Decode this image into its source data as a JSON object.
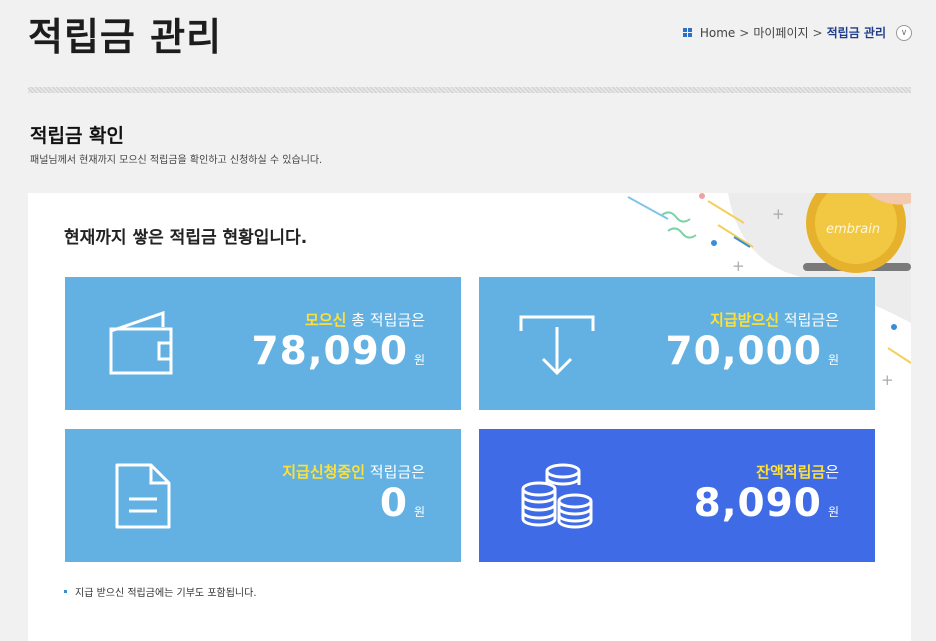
{
  "header": {
    "title": "적립금 관리",
    "breadcrumb": {
      "home": "Home",
      "parent": "마이페이지",
      "current": "적립금 관리",
      "separator": ">"
    }
  },
  "section": {
    "title": "적립금 확인",
    "description": "패널님께서 현재까지 모으신 적립금을 확인하고 신청하실 수 있습니다."
  },
  "panel": {
    "heading": "현재까지 쌓은 적립금 현황입니다.",
    "coin_text": "embrain",
    "cards": [
      {
        "highlight": "모으신",
        "suffix": " 총 적립금은",
        "amount": "78,090",
        "unit": "원",
        "icon": "wallet-icon"
      },
      {
        "highlight": "지급받으신",
        "suffix": " 적립금은",
        "amount": "70,000",
        "unit": "원",
        "icon": "download-arrow-icon"
      },
      {
        "highlight": "지급신청중인",
        "suffix": " 적립금은",
        "amount": "0",
        "unit": "원",
        "icon": "document-icon"
      },
      {
        "highlight": "잔액적립금",
        "suffix": "은",
        "amount": "8,090",
        "unit": "원",
        "icon": "coins-icon"
      }
    ],
    "note": "지급 받으신 적립금에는 기부도 포함됩니다."
  },
  "colors": {
    "card_light": "#62b1e2",
    "card_dark": "#3f6be6",
    "highlight": "#ffe033",
    "breadcrumb_current": "#1f3d8a"
  }
}
